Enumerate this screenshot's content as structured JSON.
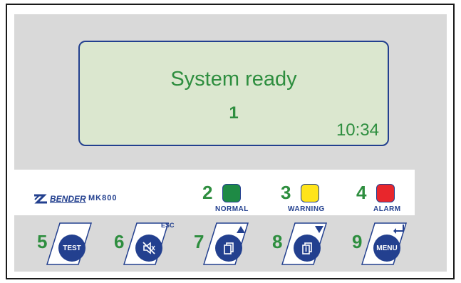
{
  "display": {
    "message": "System ready",
    "number": "1",
    "time": "10:34"
  },
  "brand": {
    "logo_text": "BENDER",
    "model": "MK800"
  },
  "leds": [
    {
      "num": "2",
      "label": "NORMAL",
      "color": "#1e8a45"
    },
    {
      "num": "3",
      "label": "WARNING",
      "color": "#ffe41a"
    },
    {
      "num": "4",
      "label": "ALARM",
      "color": "#e8262c"
    }
  ],
  "keys": [
    {
      "num": "5",
      "label": "TEST",
      "icon": "test-label"
    },
    {
      "num": "6",
      "label": "ESC",
      "icon": "mute-speaker-icon"
    },
    {
      "num": "7",
      "label": "",
      "icon": "page-up-icon"
    },
    {
      "num": "8",
      "label": "",
      "icon": "page-info-down-icon"
    },
    {
      "num": "9",
      "label": "MENU",
      "icon": "enter-icon"
    }
  ],
  "colors": {
    "accent_blue": "#23408f",
    "text_green": "#2e8e3f",
    "lcd_bg": "#dbe7cf",
    "panel_gray": "#d9d9d9"
  }
}
